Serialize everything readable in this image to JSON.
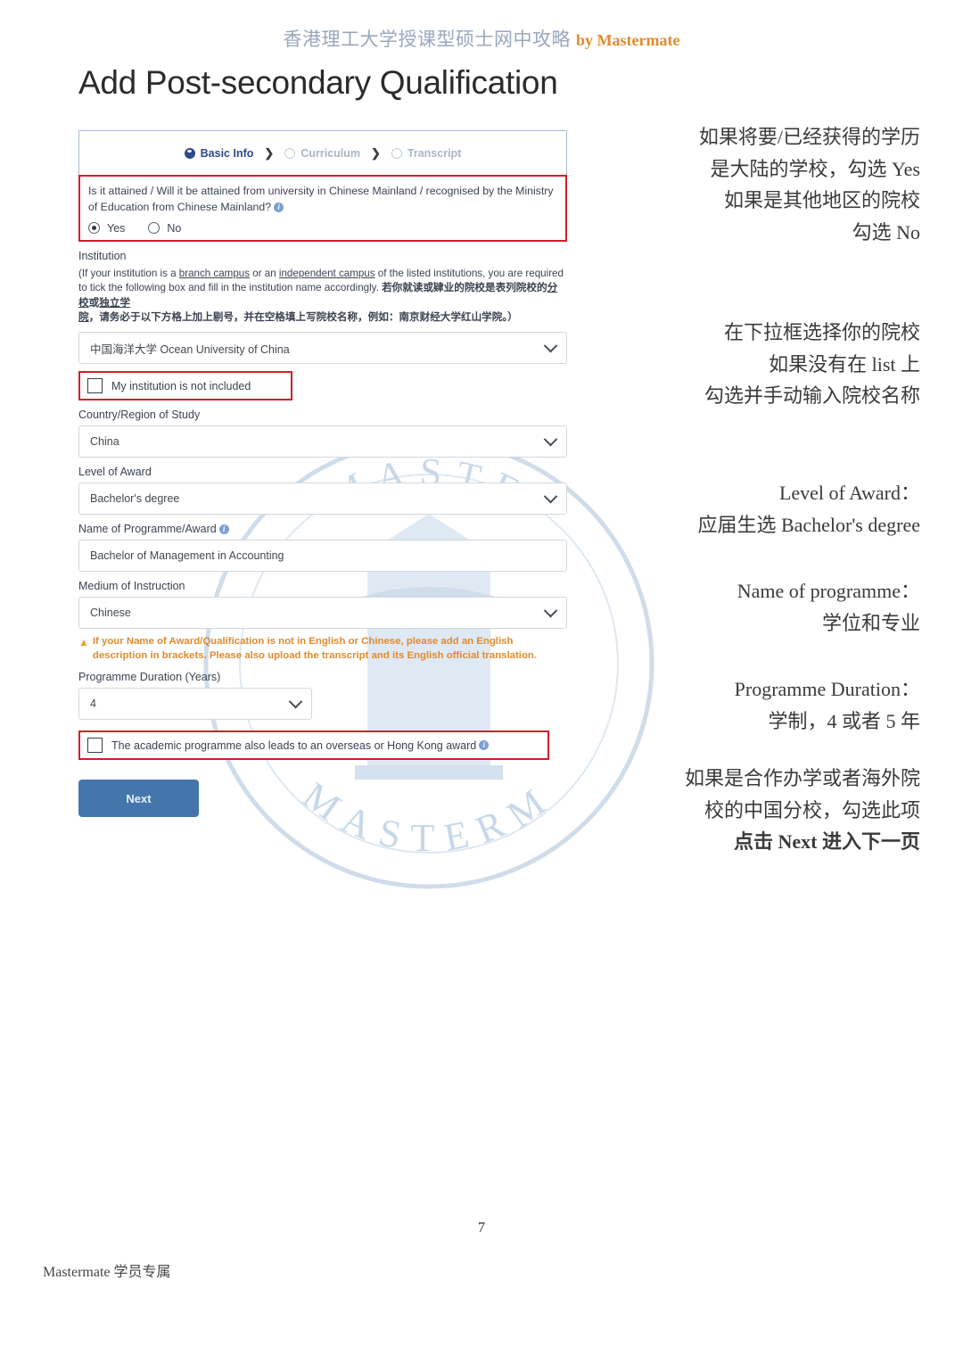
{
  "header": {
    "title_cn": "香港理工大学授课型硕士网中攻略",
    "byline": "by Mastermate"
  },
  "document": {
    "title": "Add Post-secondary Qualification",
    "page_number": "7",
    "footer_note": "Mastermate 学员专属",
    "watermark_text": "MASTERMATE"
  },
  "form": {
    "stepper": {
      "steps": [
        {
          "label": "Basic Info",
          "state": "active",
          "icon": "filled-circle-icon"
        },
        {
          "label": "Curriculum",
          "state": "inactive",
          "icon": "empty-circle-icon"
        },
        {
          "label": "Transcript",
          "state": "inactive",
          "icon": "empty-circle-icon"
        }
      ],
      "separator": "❯"
    },
    "mainland_question": {
      "text": "Is it attained / Will it be attained from university in Chinese Mainland / recognised by the Ministry of Education from Chinese Mainland?",
      "info_icon": "i",
      "options": [
        {
          "label": "Yes",
          "selected": true
        },
        {
          "label": "No",
          "selected": false
        }
      ]
    },
    "institution": {
      "label": "Institution",
      "help_line1_a": "(If your institution is a ",
      "help_link1": "branch campus",
      "help_line1_b": " or an ",
      "help_link2": "independent campus",
      "help_line1_c": " of the listed institutions, you are required to tick the following box and fill in the institution name accordingly. ",
      "help_cn_a": "若你就读或肄业的院校是表列院校的",
      "help_cn_link1": "分校",
      "help_cn_b": "或",
      "help_cn_link2": "独立学院",
      "help_cn_c": "，请务必于以下方格上加上剔号，并在空格填上写院校名称，例如：南京财经大学红山学院。）",
      "value": "中国海洋大学 Ocean University of China",
      "not_included_checkbox": {
        "label": "My institution is not included",
        "checked": false
      }
    },
    "country": {
      "label": "Country/Region of Study",
      "value": "China"
    },
    "level_of_award": {
      "label": "Level of Award",
      "value": "Bachelor's degree"
    },
    "programme_name": {
      "label": "Name of Programme/Award",
      "info_icon": "i",
      "value": "Bachelor of Management in Accounting"
    },
    "medium": {
      "label": "Medium of Instruction",
      "value": "Chinese"
    },
    "warning": {
      "icon": "warning-triangle-icon",
      "text": "If your Name of Award/Qualification is not in English or Chinese, please add an English description in brackets. Please also upload the transcript and its English official translation."
    },
    "duration": {
      "label": "Programme Duration (Years)",
      "value": "4"
    },
    "overseas_award_checkbox": {
      "label": "The academic programme also leads to an overseas or Hong Kong award",
      "info_icon": "i",
      "checked": false
    },
    "next_button": "Next"
  },
  "annotations": {
    "a1_l1": "如果将要/已经获得的学历",
    "a1_l2": "是大陆的学校，勾选 Yes",
    "a1_l3": "如果是其他地区的院校",
    "a1_l4": "勾选 No",
    "a2_l1": "在下拉框选择你的院校",
    "a2_l2": "如果没有在 list 上",
    "a2_l3": "勾选并手动输入院校名称",
    "a3_l1": "Level of Award：",
    "a3_l2": "应届生选 Bachelor's degree",
    "a4_l1": "Name of programme：",
    "a4_l2": "学位和专业",
    "a5_l1": "Programme Duration：",
    "a5_l2": "学制，4 或者 5 年",
    "a6_l1": "如果是合作办学或者海外院",
    "a6_l2": "校的中国分校，勾选此项",
    "a6_l3": "点击 Next 进入下一页"
  },
  "colors": {
    "accent_blue": "#2b4a8b",
    "button_blue": "#4476ab",
    "highlight_red": "#d01e2a",
    "warning_orange": "#e08a2e",
    "header_cn_blue": "#9aa7bd",
    "watermark_blue": "#cfdcea"
  }
}
